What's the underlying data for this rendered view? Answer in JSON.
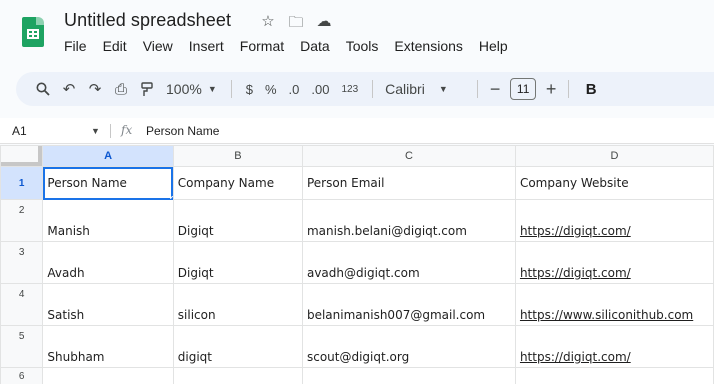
{
  "app": {
    "title": "Untitled spreadsheet",
    "title_icons": [
      "star-icon",
      "move-to-folder-icon",
      "cloud-saved-icon"
    ]
  },
  "menu": [
    "File",
    "Edit",
    "View",
    "Insert",
    "Format",
    "Data",
    "Tools",
    "Extensions",
    "Help"
  ],
  "toolbar": {
    "zoom": "100%",
    "currency": "$",
    "percent": "%",
    "decrease_decimal": ".0",
    "increase_decimal": ".00",
    "number_format": "123",
    "font": "Calibri",
    "font_size": "11",
    "minus": "−",
    "plus": "+",
    "bold": "B"
  },
  "formula_bar": {
    "cell_ref": "A1",
    "fx": "fx",
    "content": "Person Name"
  },
  "grid": {
    "columns": [
      "A",
      "B",
      "C",
      "D"
    ],
    "rows": [
      {
        "num": "1",
        "cells": [
          "Person Name",
          "Company Name",
          "Person Email",
          "Company Website"
        ]
      },
      {
        "num": "2",
        "cells": [
          "Manish",
          "Digiqt",
          "manish.belani@digiqt.com",
          "https://digiqt.com/"
        ]
      },
      {
        "num": "3",
        "cells": [
          "Avadh",
          "Digiqt",
          "avadh@digiqt.com",
          "https://digiqt.com/"
        ]
      },
      {
        "num": "4",
        "cells": [
          "Satish",
          "silicon",
          "belanimanish007@gmail.com",
          "https://www.siliconithub.com"
        ]
      },
      {
        "num": "5",
        "cells": [
          "Shubham",
          "digiqt",
          "scout@digiqt.org",
          "https://digiqt.com/"
        ]
      },
      {
        "num": "6",
        "cells": [
          "",
          "",
          "",
          ""
        ]
      }
    ]
  },
  "colors": {
    "selection": "#1a73e8",
    "header_selected_bg": "#d3e3fd",
    "sheets_green": "#1ea362",
    "toolbar_bg": "#edf2fa"
  }
}
